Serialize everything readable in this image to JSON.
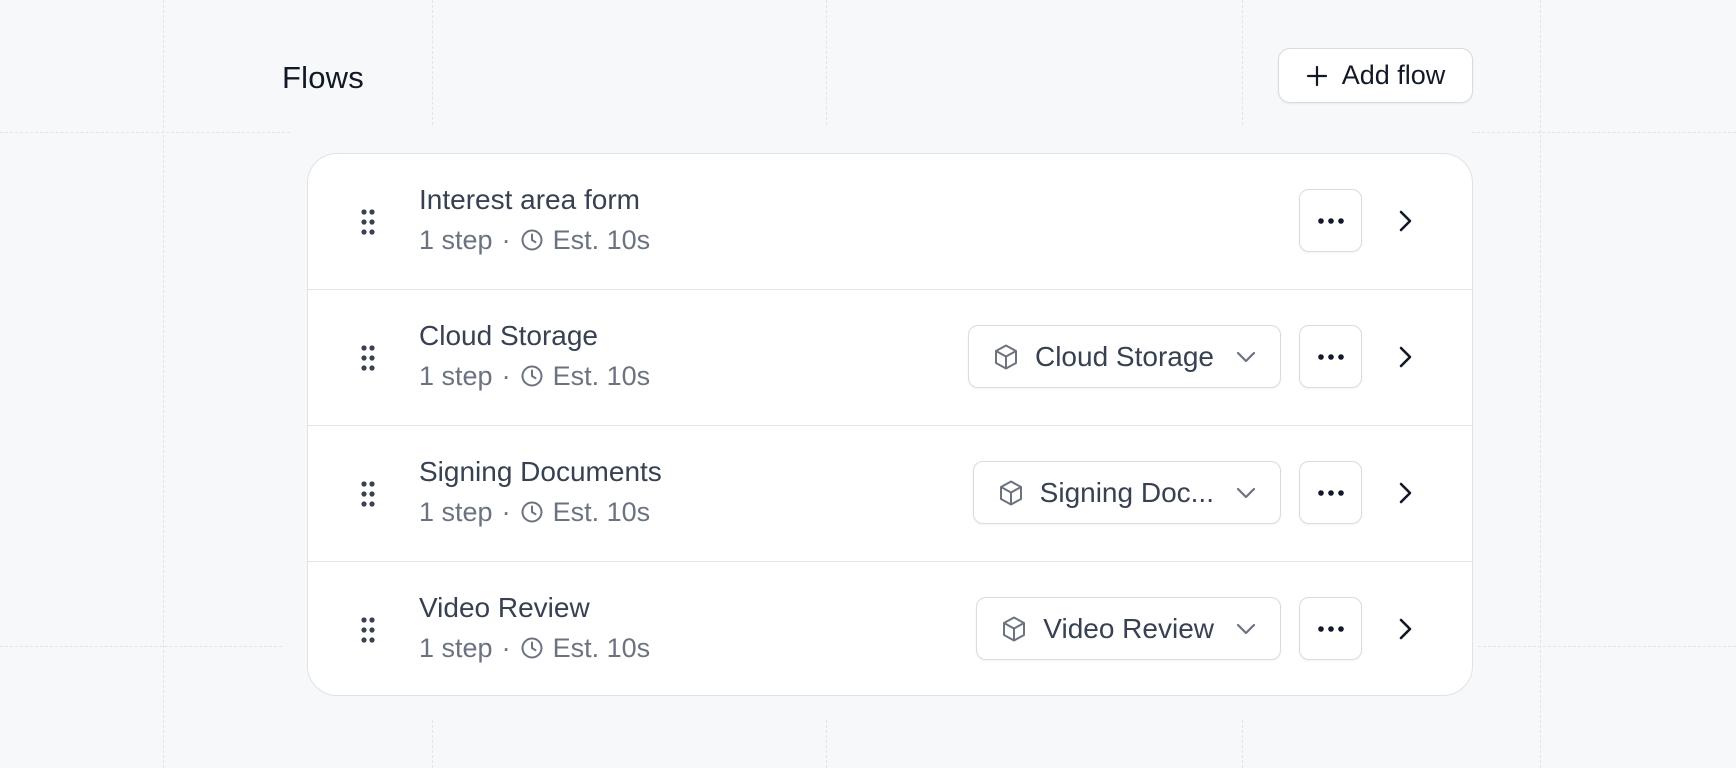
{
  "header": {
    "title": "Flows",
    "add_label": "Add flow"
  },
  "flows": [
    {
      "title": "Interest area form",
      "steps": "1 step",
      "separator": "·",
      "estimate": "Est. 10s",
      "select_label": null
    },
    {
      "title": "Cloud Storage",
      "steps": "1 step",
      "separator": "·",
      "estimate": "Est. 10s",
      "select_label": "Cloud Storage"
    },
    {
      "title": "Signing Documents",
      "steps": "1 step",
      "separator": "·",
      "estimate": "Est. 10s",
      "select_label": "Signing Doc..."
    },
    {
      "title": "Video Review",
      "steps": "1 step",
      "separator": "·",
      "estimate": "Est. 10s",
      "select_label": "Video Review"
    }
  ],
  "icons": {
    "add": "plus-icon",
    "drag": "drag-handle-icon",
    "clock": "clock-icon",
    "integration": "cube-icon",
    "dropdown": "chevron-down-icon",
    "more": "more-horizontal-icon",
    "open": "chevron-right-icon"
  },
  "colors": {
    "background": "#f7f8fa",
    "panel": "#ffffff",
    "border": "#d8dbe0",
    "title_text": "#111827",
    "row_title": "#374151",
    "muted_text": "#6b7280"
  }
}
